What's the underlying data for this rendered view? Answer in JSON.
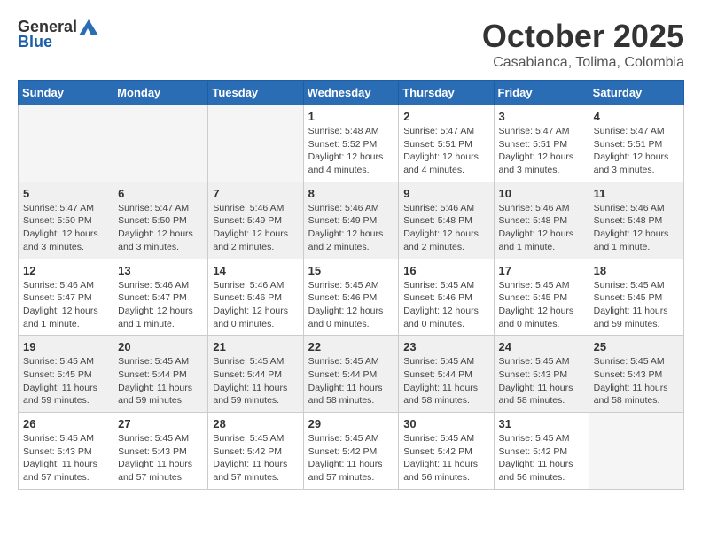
{
  "logo": {
    "general": "General",
    "blue": "Blue"
  },
  "title": "October 2025",
  "location": "Casabianca, Tolima, Colombia",
  "headers": [
    "Sunday",
    "Monday",
    "Tuesday",
    "Wednesday",
    "Thursday",
    "Friday",
    "Saturday"
  ],
  "weeks": [
    [
      {
        "day": "",
        "info": ""
      },
      {
        "day": "",
        "info": ""
      },
      {
        "day": "",
        "info": ""
      },
      {
        "day": "1",
        "info": "Sunrise: 5:48 AM\nSunset: 5:52 PM\nDaylight: 12 hours\nand 4 minutes."
      },
      {
        "day": "2",
        "info": "Sunrise: 5:47 AM\nSunset: 5:51 PM\nDaylight: 12 hours\nand 4 minutes."
      },
      {
        "day": "3",
        "info": "Sunrise: 5:47 AM\nSunset: 5:51 PM\nDaylight: 12 hours\nand 3 minutes."
      },
      {
        "day": "4",
        "info": "Sunrise: 5:47 AM\nSunset: 5:51 PM\nDaylight: 12 hours\nand 3 minutes."
      }
    ],
    [
      {
        "day": "5",
        "info": "Sunrise: 5:47 AM\nSunset: 5:50 PM\nDaylight: 12 hours\nand 3 minutes."
      },
      {
        "day": "6",
        "info": "Sunrise: 5:47 AM\nSunset: 5:50 PM\nDaylight: 12 hours\nand 3 minutes."
      },
      {
        "day": "7",
        "info": "Sunrise: 5:46 AM\nSunset: 5:49 PM\nDaylight: 12 hours\nand 2 minutes."
      },
      {
        "day": "8",
        "info": "Sunrise: 5:46 AM\nSunset: 5:49 PM\nDaylight: 12 hours\nand 2 minutes."
      },
      {
        "day": "9",
        "info": "Sunrise: 5:46 AM\nSunset: 5:48 PM\nDaylight: 12 hours\nand 2 minutes."
      },
      {
        "day": "10",
        "info": "Sunrise: 5:46 AM\nSunset: 5:48 PM\nDaylight: 12 hours\nand 1 minute."
      },
      {
        "day": "11",
        "info": "Sunrise: 5:46 AM\nSunset: 5:48 PM\nDaylight: 12 hours\nand 1 minute."
      }
    ],
    [
      {
        "day": "12",
        "info": "Sunrise: 5:46 AM\nSunset: 5:47 PM\nDaylight: 12 hours\nand 1 minute."
      },
      {
        "day": "13",
        "info": "Sunrise: 5:46 AM\nSunset: 5:47 PM\nDaylight: 12 hours\nand 1 minute."
      },
      {
        "day": "14",
        "info": "Sunrise: 5:46 AM\nSunset: 5:46 PM\nDaylight: 12 hours\nand 0 minutes."
      },
      {
        "day": "15",
        "info": "Sunrise: 5:45 AM\nSunset: 5:46 PM\nDaylight: 12 hours\nand 0 minutes."
      },
      {
        "day": "16",
        "info": "Sunrise: 5:45 AM\nSunset: 5:46 PM\nDaylight: 12 hours\nand 0 minutes."
      },
      {
        "day": "17",
        "info": "Sunrise: 5:45 AM\nSunset: 5:45 PM\nDaylight: 12 hours\nand 0 minutes."
      },
      {
        "day": "18",
        "info": "Sunrise: 5:45 AM\nSunset: 5:45 PM\nDaylight: 11 hours\nand 59 minutes."
      }
    ],
    [
      {
        "day": "19",
        "info": "Sunrise: 5:45 AM\nSunset: 5:45 PM\nDaylight: 11 hours\nand 59 minutes."
      },
      {
        "day": "20",
        "info": "Sunrise: 5:45 AM\nSunset: 5:44 PM\nDaylight: 11 hours\nand 59 minutes."
      },
      {
        "day": "21",
        "info": "Sunrise: 5:45 AM\nSunset: 5:44 PM\nDaylight: 11 hours\nand 59 minutes."
      },
      {
        "day": "22",
        "info": "Sunrise: 5:45 AM\nSunset: 5:44 PM\nDaylight: 11 hours\nand 58 minutes."
      },
      {
        "day": "23",
        "info": "Sunrise: 5:45 AM\nSunset: 5:44 PM\nDaylight: 11 hours\nand 58 minutes."
      },
      {
        "day": "24",
        "info": "Sunrise: 5:45 AM\nSunset: 5:43 PM\nDaylight: 11 hours\nand 58 minutes."
      },
      {
        "day": "25",
        "info": "Sunrise: 5:45 AM\nSunset: 5:43 PM\nDaylight: 11 hours\nand 58 minutes."
      }
    ],
    [
      {
        "day": "26",
        "info": "Sunrise: 5:45 AM\nSunset: 5:43 PM\nDaylight: 11 hours\nand 57 minutes."
      },
      {
        "day": "27",
        "info": "Sunrise: 5:45 AM\nSunset: 5:43 PM\nDaylight: 11 hours\nand 57 minutes."
      },
      {
        "day": "28",
        "info": "Sunrise: 5:45 AM\nSunset: 5:42 PM\nDaylight: 11 hours\nand 57 minutes."
      },
      {
        "day": "29",
        "info": "Sunrise: 5:45 AM\nSunset: 5:42 PM\nDaylight: 11 hours\nand 57 minutes."
      },
      {
        "day": "30",
        "info": "Sunrise: 5:45 AM\nSunset: 5:42 PM\nDaylight: 11 hours\nand 56 minutes."
      },
      {
        "day": "31",
        "info": "Sunrise: 5:45 AM\nSunset: 5:42 PM\nDaylight: 11 hours\nand 56 minutes."
      },
      {
        "day": "",
        "info": ""
      }
    ]
  ]
}
